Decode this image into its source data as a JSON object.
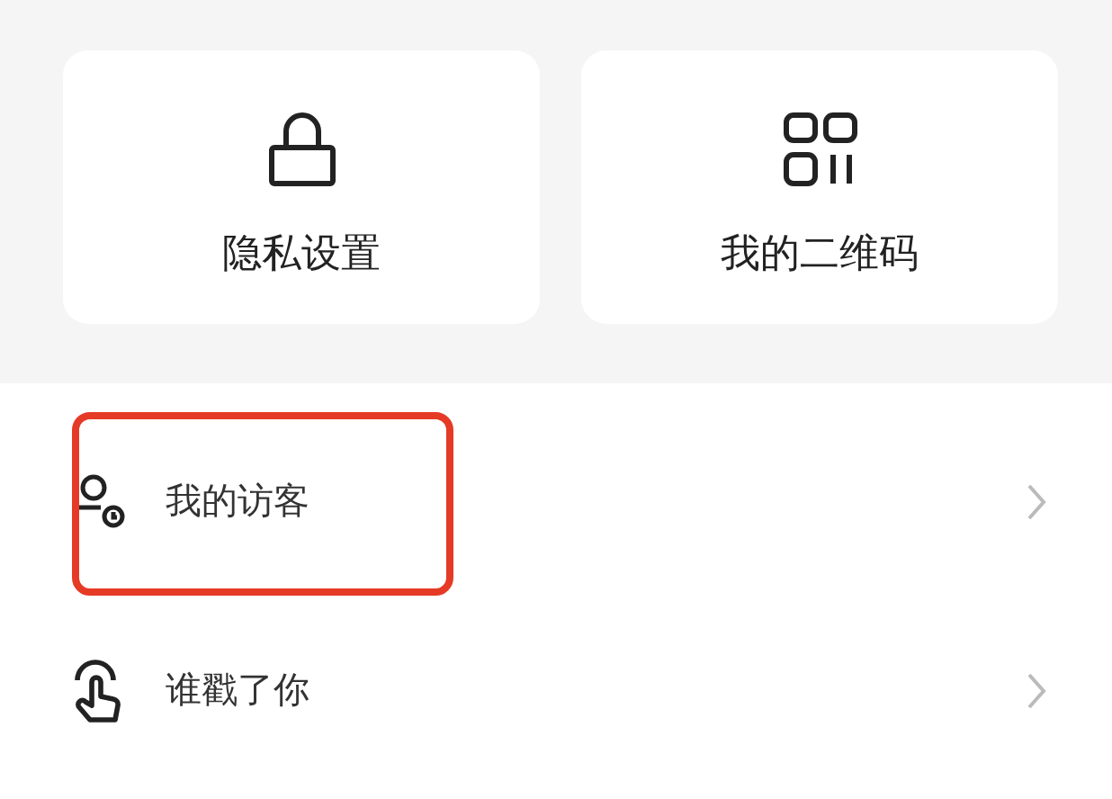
{
  "shortcuts": [
    {
      "kind": "lock",
      "label": "隐私设置"
    },
    {
      "kind": "code",
      "label": "我的二维码"
    }
  ],
  "rows": [
    {
      "kind": "visitor",
      "label": "我的访客",
      "highlighted": true
    },
    {
      "kind": "tap",
      "label": "谁戳了你",
      "highlighted": false
    }
  ]
}
